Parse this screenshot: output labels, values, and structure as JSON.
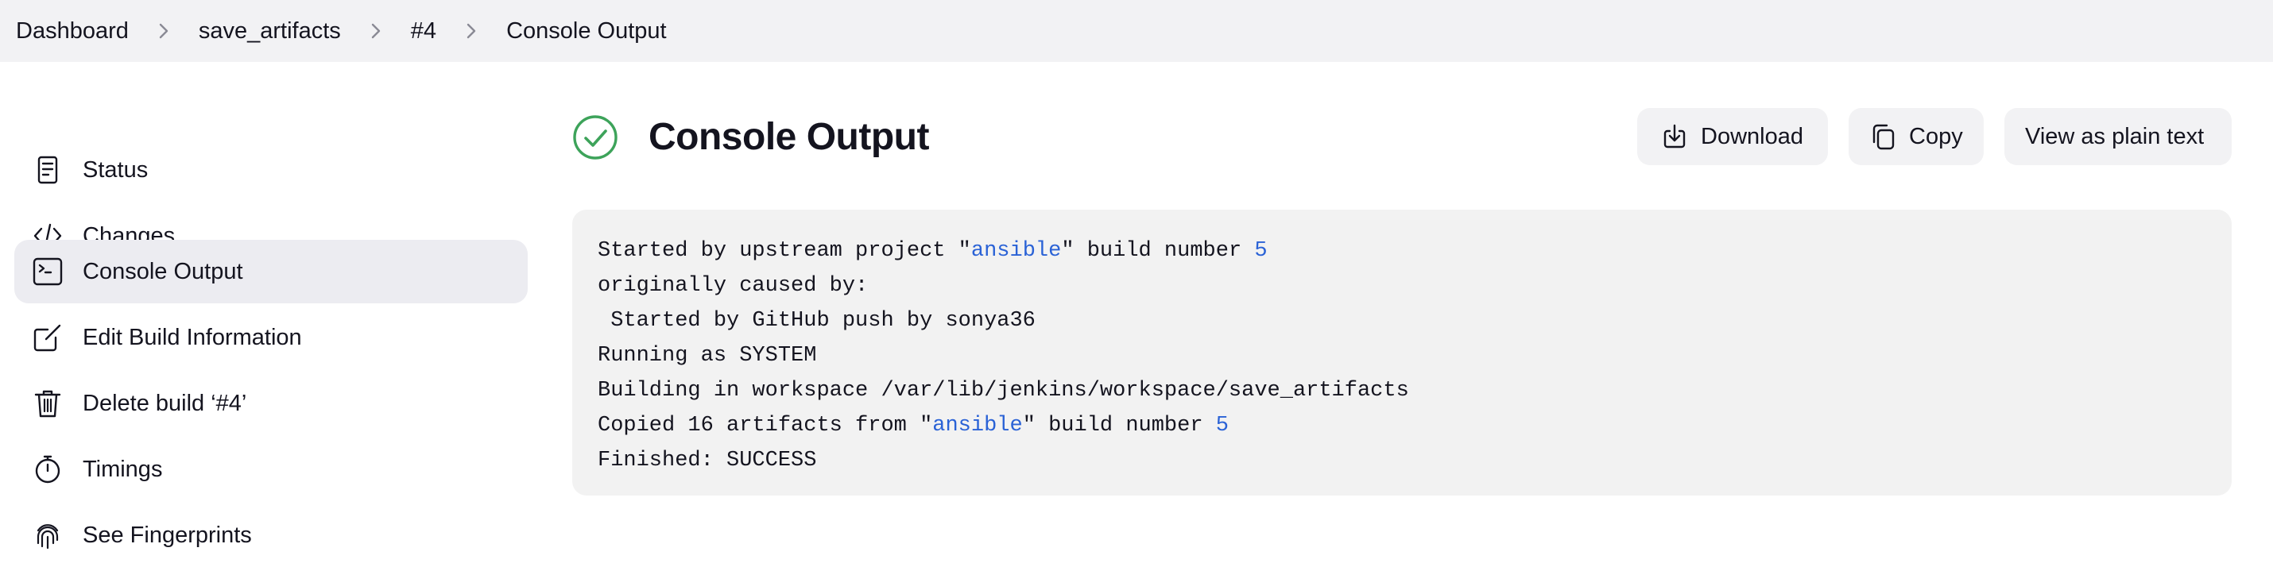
{
  "breadcrumb": {
    "items": [
      {
        "label": "Dashboard"
      },
      {
        "label": "save_artifacts"
      },
      {
        "label": "#4"
      },
      {
        "label": "Console Output"
      }
    ]
  },
  "sidebar": {
    "items": [
      {
        "label": "Status",
        "icon": "status-doc-icon"
      },
      {
        "label": "Changes",
        "icon": "code-icon"
      },
      {
        "label": "Console Output",
        "icon": "terminal-icon",
        "active": true
      },
      {
        "label": "Edit Build Information",
        "icon": "edit-icon"
      },
      {
        "label": "Delete build ‘#4’",
        "icon": "trash-icon"
      },
      {
        "label": "Timings",
        "icon": "stopwatch-icon"
      },
      {
        "label": "See Fingerprints",
        "icon": "fingerprint-icon"
      }
    ]
  },
  "page": {
    "title": "Console Output",
    "status": "success",
    "status_color": "#3da35a"
  },
  "actions": {
    "download_label": "Download",
    "copy_label": "Copy",
    "plain_text_label": "View as plain text"
  },
  "console": {
    "line1": {
      "pre": "Started by upstream project \"",
      "link": "ansible",
      "mid": "\" build number ",
      "num": "5"
    },
    "line2": "originally caused by:",
    "line3": " Started by GitHub push by sonya36",
    "line4": "Running as SYSTEM",
    "line5": "Building in workspace /var/lib/jenkins/workspace/save_artifacts",
    "line6": {
      "pre": "Copied 16 artifacts from \"",
      "link": "ansible",
      "mid": "\" build number ",
      "num": "5"
    },
    "line7": "Finished: SUCCESS"
  },
  "colors": {
    "link": "#2a62d6",
    "accent_bg": "#ececf1",
    "panel_bg": "#f2f2f2"
  }
}
